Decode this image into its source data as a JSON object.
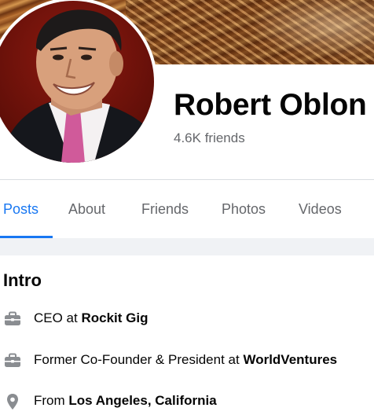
{
  "profile": {
    "name": "Robert Oblon",
    "friends": "4.6K friends"
  },
  "tabs": [
    {
      "label": "Posts",
      "active": true
    },
    {
      "label": "About"
    },
    {
      "label": "Friends"
    },
    {
      "label": "Photos"
    },
    {
      "label": "Videos"
    }
  ],
  "intro": {
    "title": "Intro",
    "items": [
      {
        "icon": "briefcase-icon",
        "prefix": "CEO at ",
        "bold": "Rockit Gig"
      },
      {
        "icon": "briefcase-icon",
        "prefix": "Former Co-Founder & President at ",
        "bold": "WorldVentures"
      },
      {
        "icon": "location-pin-icon",
        "prefix": "From ",
        "bold": "Los Angeles, California"
      }
    ]
  },
  "colors": {
    "accent": "#1877f2",
    "secondary_text": "#65676b",
    "divider": "#dadde1",
    "band": "#f0f2f5"
  }
}
